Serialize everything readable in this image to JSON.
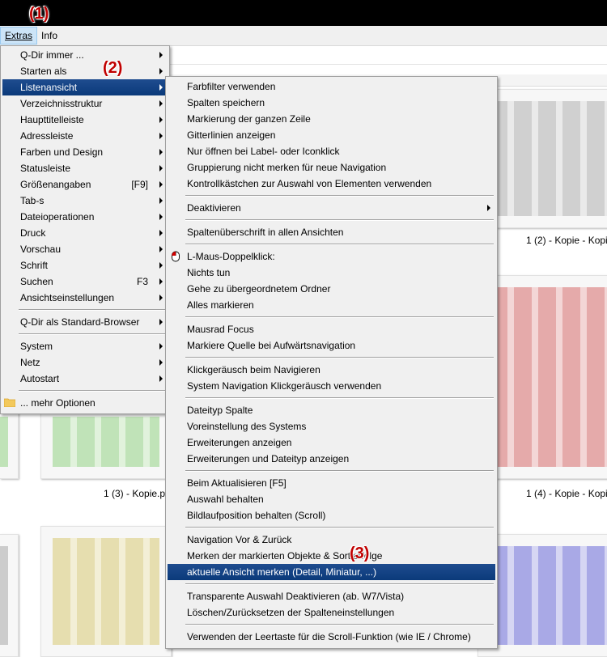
{
  "annotations": {
    "a1": "(1)",
    "a2": "(2)",
    "a3": "(3)"
  },
  "menubar": {
    "extras": "Extras",
    "info": "Info"
  },
  "extras_menu": {
    "items": [
      {
        "label": "Q-Dir immer ...",
        "shortcut": "",
        "submenu": true
      },
      {
        "label": "Starten als",
        "shortcut": "",
        "submenu": true
      },
      {
        "label": "Listenansicht",
        "shortcut": "",
        "submenu": true
      },
      {
        "label": "Verzeichnisstruktur",
        "shortcut": "",
        "submenu": true
      },
      {
        "label": "Haupttitelleiste",
        "shortcut": "",
        "submenu": true
      },
      {
        "label": "Adressleiste",
        "shortcut": "",
        "submenu": true
      },
      {
        "label": "Farben und Design",
        "shortcut": "",
        "submenu": true
      },
      {
        "label": "Statusleiste",
        "shortcut": "",
        "submenu": true
      },
      {
        "label": "Größenangaben",
        "shortcut": "[F9]",
        "submenu": true
      },
      {
        "label": "Tab-s",
        "shortcut": "",
        "submenu": true
      },
      {
        "label": "Dateioperationen",
        "shortcut": "",
        "submenu": true
      },
      {
        "label": "Druck",
        "shortcut": "",
        "submenu": true
      },
      {
        "label": "Vorschau",
        "shortcut": "",
        "submenu": true
      },
      {
        "label": "Schrift",
        "shortcut": "",
        "submenu": true
      },
      {
        "label": "Suchen",
        "shortcut": "F3",
        "submenu": true
      },
      {
        "label": "Ansichtseinstellungen",
        "shortcut": "",
        "submenu": true
      },
      {
        "label": "Q-Dir als Standard-Browser",
        "shortcut": "",
        "submenu": true
      },
      {
        "label": "System",
        "shortcut": "",
        "submenu": true
      },
      {
        "label": "Netz",
        "shortcut": "",
        "submenu": true
      },
      {
        "label": "Autostart",
        "shortcut": "",
        "submenu": true
      },
      {
        "label": "... mehr Optionen",
        "shortcut": "",
        "submenu": false
      }
    ]
  },
  "list_menu": {
    "items": [
      {
        "label": "Farbfilter verwenden"
      },
      {
        "label": "Spalten speichern"
      },
      {
        "label": "Markierung der ganzen Zeile"
      },
      {
        "label": "Gitterlinien anzeigen"
      },
      {
        "label": "Nur öffnen bei Label- oder Iconklick"
      },
      {
        "label": "Gruppierung nicht merken für neue Navigation"
      },
      {
        "label": "Kontrollkästchen zur Auswahl von Elementen verwenden"
      },
      {
        "label": "Deaktivieren"
      },
      {
        "label": "Spaltenüberschrift in allen Ansichten"
      },
      {
        "label": "L-Maus-Doppelklick:"
      },
      {
        "label": "Nichts tun"
      },
      {
        "label": "Gehe zu übergeordnetem Ordner"
      },
      {
        "label": "Alles markieren"
      },
      {
        "label": "Mausrad Focus"
      },
      {
        "label": "Markiere Quelle bei Aufwärtsnavigation"
      },
      {
        "label": "Klickgeräusch beim Navigieren"
      },
      {
        "label": "System Navigation Klickgeräusch verwenden"
      },
      {
        "label": "Dateityp Spalte"
      },
      {
        "label": "Voreinstellung des Systems"
      },
      {
        "label": "Erweiterungen anzeigen"
      },
      {
        "label": "Erweiterungen und Dateityp anzeigen"
      },
      {
        "label": "Beim Aktualisieren [F5]"
      },
      {
        "label": "Auswahl behalten"
      },
      {
        "label": "Bildlaufposition behalten (Scroll)"
      },
      {
        "label": "Navigation Vor & Zurück"
      },
      {
        "label": "Merken der markierten Objekte & Sortierfolge"
      },
      {
        "label": "aktuelle Ansicht merken (Detail, Miniatur, ...)"
      },
      {
        "label": "Transparente Auswahl Deaktivieren (ab. W7/Vista)"
      },
      {
        "label": "Löschen/Zurücksetzen der Spalteneinstellungen"
      },
      {
        "label": "Verwenden der Leertaste für die Scroll-Funktion (wie IE / Chrome)"
      }
    ]
  },
  "files": [
    {
      "caption": "1 (2) - Kopie - Kopi"
    },
    {
      "caption": "1 (3) - Kopie.p"
    },
    {
      "caption": "1 (4) - Kopie - Kopi"
    }
  ],
  "colors": {
    "highlight": "#0b3a7a",
    "annot": "#c00000"
  }
}
